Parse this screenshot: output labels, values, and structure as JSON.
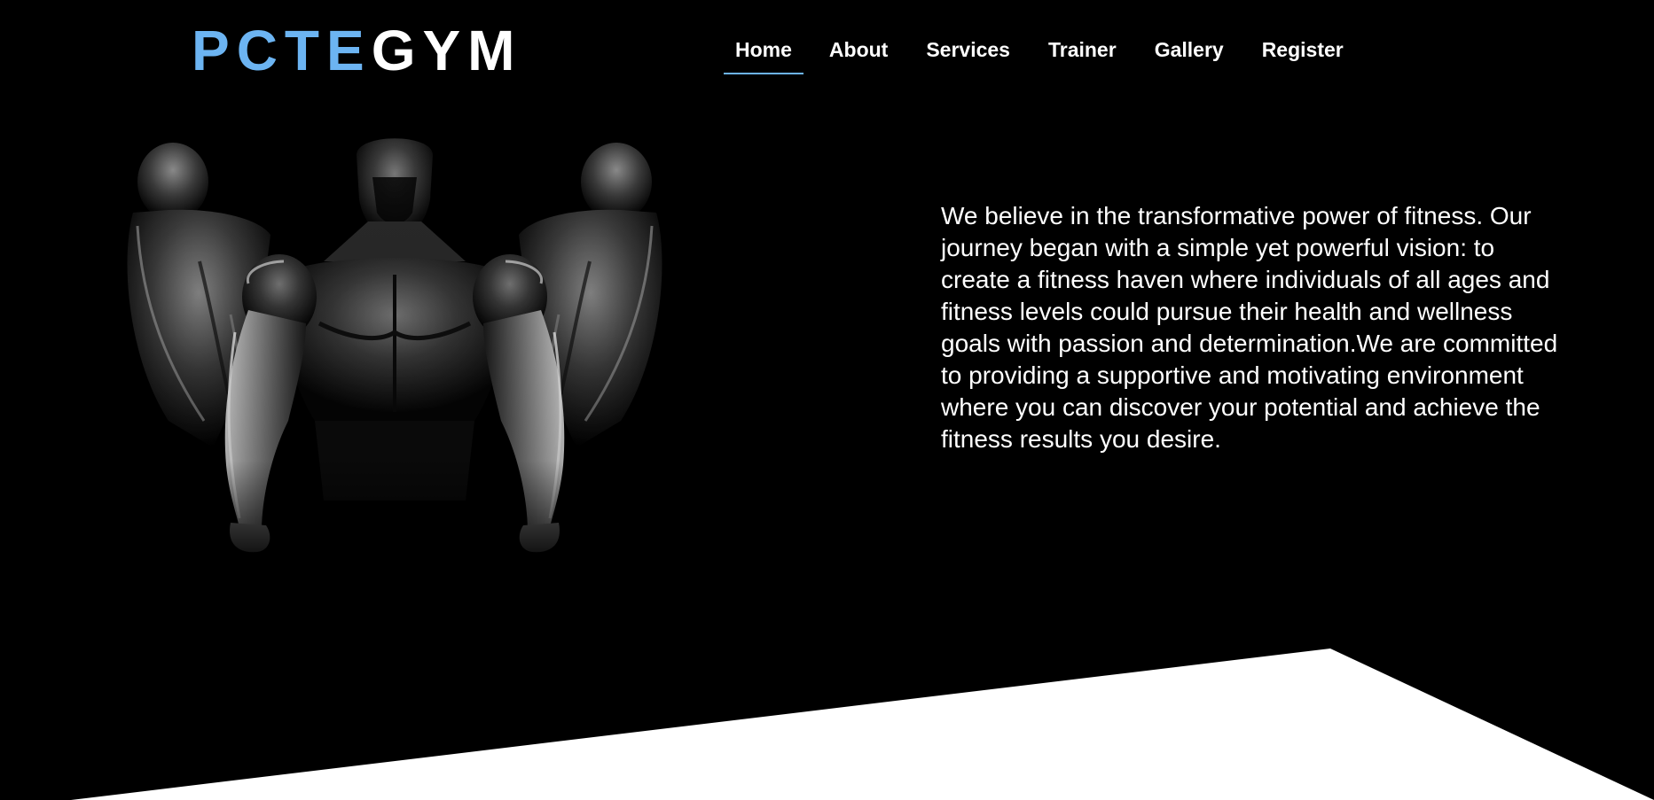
{
  "brand": {
    "part1": "PCTE",
    "part2": "GYM",
    "accent_color": "#6cb4f2"
  },
  "nav": {
    "items": [
      {
        "label": "Home",
        "active": true
      },
      {
        "label": "About",
        "active": false
      },
      {
        "label": "Services",
        "active": false
      },
      {
        "label": "Trainer",
        "active": false
      },
      {
        "label": "Gallery",
        "active": false
      },
      {
        "label": "Register",
        "active": false
      }
    ]
  },
  "hero": {
    "image_subject": "three muscular men silhouette",
    "about_text": "We believe in the transformative power of fitness. Our journey began with a simple yet powerful vision: to create a fitness haven where individuals of all ages and fitness levels could pursue their health and wellness goals with passion and determination.We are committed to providing a supportive and motivating environment where you can discover your potential and achieve the fitness results you desire."
  },
  "colors": {
    "background": "#000000",
    "text": "#ffffff",
    "bottom_shape": "#ffffff"
  }
}
